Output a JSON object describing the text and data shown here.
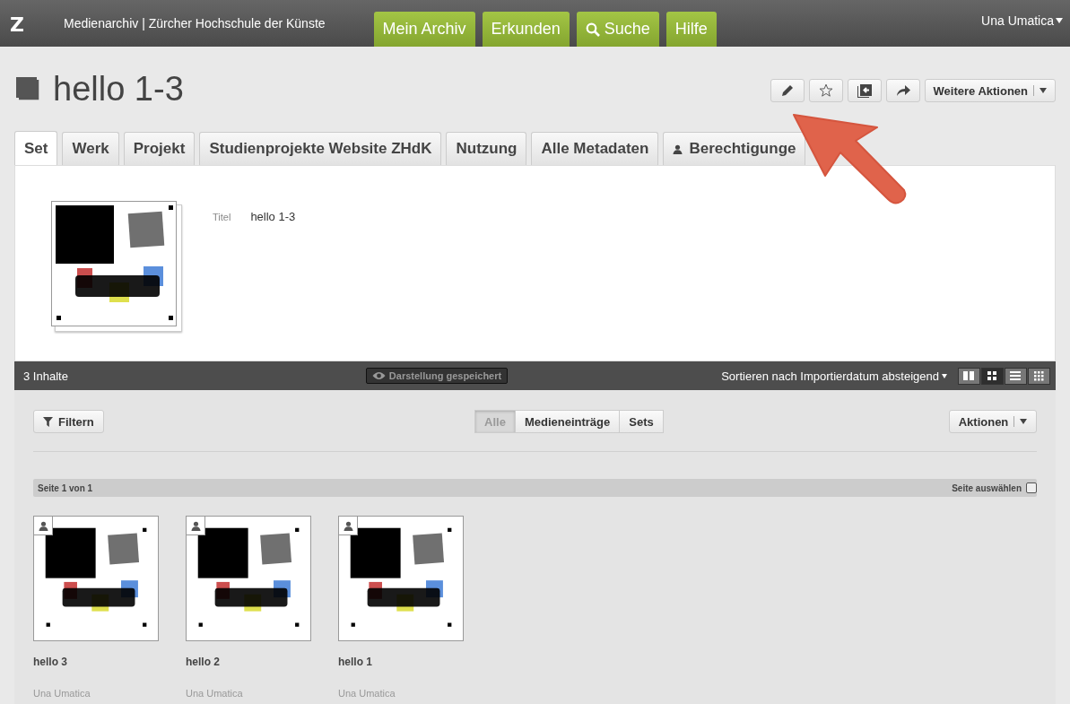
{
  "topbar": {
    "logo": "Z",
    "site_title": "Medienarchiv | Zürcher Hochschule der Künste",
    "nav": [
      {
        "label": "Mein Archiv",
        "kind": "plain"
      },
      {
        "label": "Erkunden",
        "kind": "plain"
      },
      {
        "label": "Suche",
        "kind": "search"
      },
      {
        "label": "Hilfe",
        "kind": "plain"
      }
    ],
    "user": "Una Umatica"
  },
  "header": {
    "title": "hello 1-3",
    "more_actions": "Weitere Aktionen"
  },
  "tabs": [
    {
      "label": "Set",
      "selected": true,
      "kind": "plain"
    },
    {
      "label": "Werk",
      "selected": false,
      "kind": "plain"
    },
    {
      "label": "Projekt",
      "selected": false,
      "kind": "plain"
    },
    {
      "label": "Studienprojekte Website ZHdK",
      "selected": false,
      "kind": "plain"
    },
    {
      "label": "Nutzung",
      "selected": false,
      "kind": "plain"
    },
    {
      "label": "Alle Metadaten",
      "selected": false,
      "kind": "plain"
    },
    {
      "label": "Berechtigunge",
      "selected": false,
      "kind": "person"
    }
  ],
  "set": {
    "fields": [
      {
        "label": "Titel",
        "value": "hello 1-3"
      }
    ]
  },
  "toolbar": {
    "count": "3 Inhalte",
    "saved_view": "Darstellung gespeichert",
    "sort": "Sortieren nach Importierdatum absteigend",
    "views": [
      {
        "kind": "columns",
        "selected": false
      },
      {
        "kind": "grid",
        "selected": true
      },
      {
        "kind": "list",
        "selected": false
      },
      {
        "kind": "tiles",
        "selected": false
      }
    ]
  },
  "filter": {
    "filter_button": "Filtern",
    "types": [
      {
        "label": "Alle",
        "selected": true
      },
      {
        "label": "Medieneinträge",
        "selected": false
      },
      {
        "label": "Sets",
        "selected": false
      }
    ],
    "actions": "Aktionen"
  },
  "pagination": {
    "page": "Seite 1 von 1",
    "select_page": "Seite auswählen",
    "checked": false
  },
  "items": [
    {
      "title": "hello 3",
      "author": "Una Umatica"
    },
    {
      "title": "hello 2",
      "author": "Una Umatica"
    },
    {
      "title": "hello 1",
      "author": "Una Umatica"
    }
  ]
}
